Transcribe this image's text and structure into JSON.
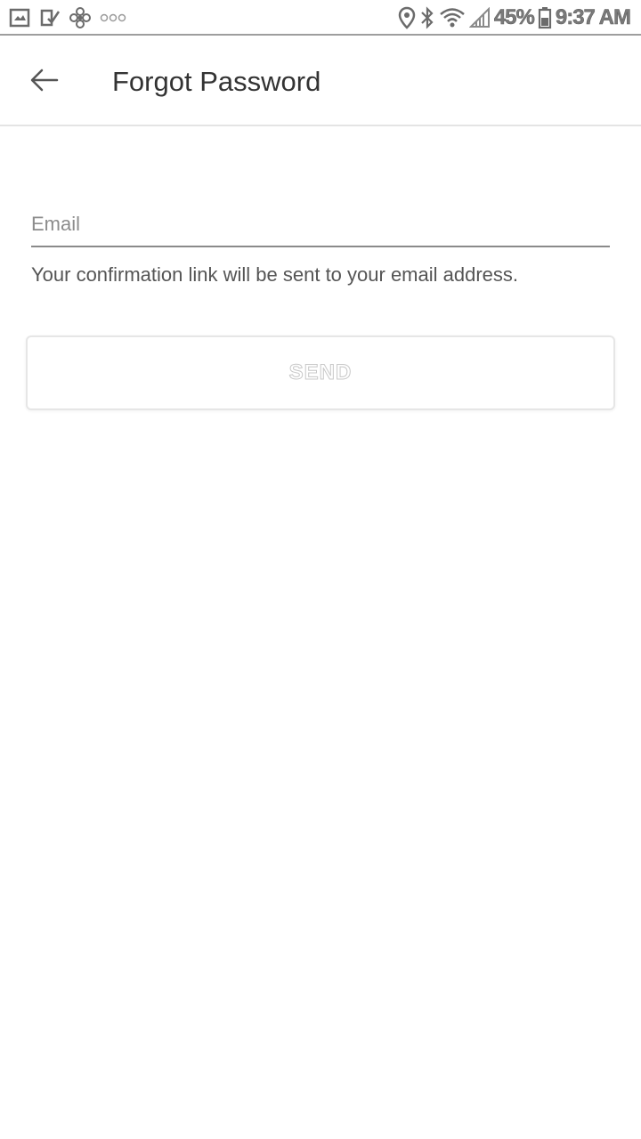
{
  "status_bar": {
    "icons_left": [
      "gallery-icon",
      "checklist-icon",
      "fan-icon",
      "more-dots-icon"
    ],
    "icons_right": [
      "location-icon",
      "bluetooth-icon",
      "wifi-icon",
      "signal-icon",
      "battery-icon"
    ],
    "battery": "45%",
    "time": "9:37 AM"
  },
  "app_bar": {
    "back_icon": "arrow-left-icon",
    "title": "Forgot Password"
  },
  "form": {
    "email_placeholder": "Email",
    "email_value": "",
    "helper_text": "Your confirmation link will be sent to your email address.",
    "send_label": "SEND"
  }
}
